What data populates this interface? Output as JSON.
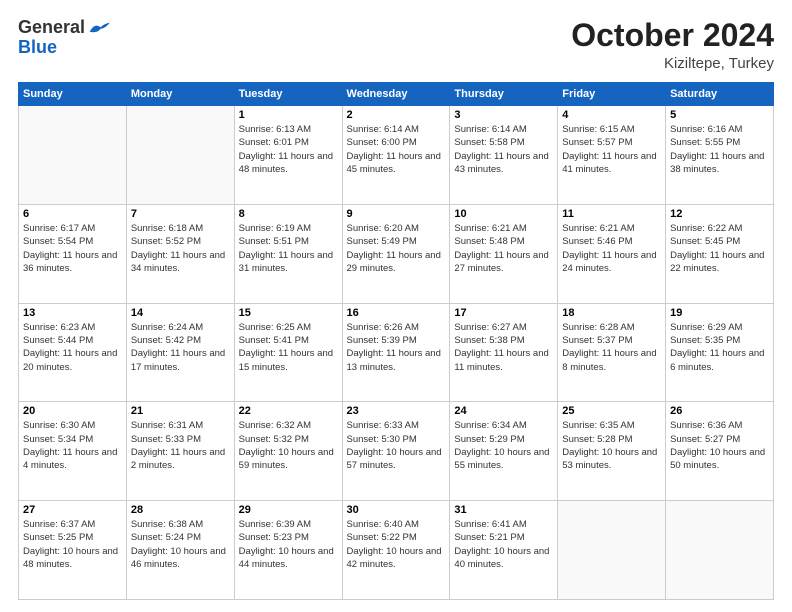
{
  "logo": {
    "line1": "General",
    "line2": "Blue"
  },
  "title": "October 2024",
  "location": "Kiziltepe, Turkey",
  "weekdays": [
    "Sunday",
    "Monday",
    "Tuesday",
    "Wednesday",
    "Thursday",
    "Friday",
    "Saturday"
  ],
  "weeks": [
    [
      {
        "day": "",
        "info": ""
      },
      {
        "day": "",
        "info": ""
      },
      {
        "day": "1",
        "info": "Sunrise: 6:13 AM\nSunset: 6:01 PM\nDaylight: 11 hours and 48 minutes."
      },
      {
        "day": "2",
        "info": "Sunrise: 6:14 AM\nSunset: 6:00 PM\nDaylight: 11 hours and 45 minutes."
      },
      {
        "day": "3",
        "info": "Sunrise: 6:14 AM\nSunset: 5:58 PM\nDaylight: 11 hours and 43 minutes."
      },
      {
        "day": "4",
        "info": "Sunrise: 6:15 AM\nSunset: 5:57 PM\nDaylight: 11 hours and 41 minutes."
      },
      {
        "day": "5",
        "info": "Sunrise: 6:16 AM\nSunset: 5:55 PM\nDaylight: 11 hours and 38 minutes."
      }
    ],
    [
      {
        "day": "6",
        "info": "Sunrise: 6:17 AM\nSunset: 5:54 PM\nDaylight: 11 hours and 36 minutes."
      },
      {
        "day": "7",
        "info": "Sunrise: 6:18 AM\nSunset: 5:52 PM\nDaylight: 11 hours and 34 minutes."
      },
      {
        "day": "8",
        "info": "Sunrise: 6:19 AM\nSunset: 5:51 PM\nDaylight: 11 hours and 31 minutes."
      },
      {
        "day": "9",
        "info": "Sunrise: 6:20 AM\nSunset: 5:49 PM\nDaylight: 11 hours and 29 minutes."
      },
      {
        "day": "10",
        "info": "Sunrise: 6:21 AM\nSunset: 5:48 PM\nDaylight: 11 hours and 27 minutes."
      },
      {
        "day": "11",
        "info": "Sunrise: 6:21 AM\nSunset: 5:46 PM\nDaylight: 11 hours and 24 minutes."
      },
      {
        "day": "12",
        "info": "Sunrise: 6:22 AM\nSunset: 5:45 PM\nDaylight: 11 hours and 22 minutes."
      }
    ],
    [
      {
        "day": "13",
        "info": "Sunrise: 6:23 AM\nSunset: 5:44 PM\nDaylight: 11 hours and 20 minutes."
      },
      {
        "day": "14",
        "info": "Sunrise: 6:24 AM\nSunset: 5:42 PM\nDaylight: 11 hours and 17 minutes."
      },
      {
        "day": "15",
        "info": "Sunrise: 6:25 AM\nSunset: 5:41 PM\nDaylight: 11 hours and 15 minutes."
      },
      {
        "day": "16",
        "info": "Sunrise: 6:26 AM\nSunset: 5:39 PM\nDaylight: 11 hours and 13 minutes."
      },
      {
        "day": "17",
        "info": "Sunrise: 6:27 AM\nSunset: 5:38 PM\nDaylight: 11 hours and 11 minutes."
      },
      {
        "day": "18",
        "info": "Sunrise: 6:28 AM\nSunset: 5:37 PM\nDaylight: 11 hours and 8 minutes."
      },
      {
        "day": "19",
        "info": "Sunrise: 6:29 AM\nSunset: 5:35 PM\nDaylight: 11 hours and 6 minutes."
      }
    ],
    [
      {
        "day": "20",
        "info": "Sunrise: 6:30 AM\nSunset: 5:34 PM\nDaylight: 11 hours and 4 minutes."
      },
      {
        "day": "21",
        "info": "Sunrise: 6:31 AM\nSunset: 5:33 PM\nDaylight: 11 hours and 2 minutes."
      },
      {
        "day": "22",
        "info": "Sunrise: 6:32 AM\nSunset: 5:32 PM\nDaylight: 10 hours and 59 minutes."
      },
      {
        "day": "23",
        "info": "Sunrise: 6:33 AM\nSunset: 5:30 PM\nDaylight: 10 hours and 57 minutes."
      },
      {
        "day": "24",
        "info": "Sunrise: 6:34 AM\nSunset: 5:29 PM\nDaylight: 10 hours and 55 minutes."
      },
      {
        "day": "25",
        "info": "Sunrise: 6:35 AM\nSunset: 5:28 PM\nDaylight: 10 hours and 53 minutes."
      },
      {
        "day": "26",
        "info": "Sunrise: 6:36 AM\nSunset: 5:27 PM\nDaylight: 10 hours and 50 minutes."
      }
    ],
    [
      {
        "day": "27",
        "info": "Sunrise: 6:37 AM\nSunset: 5:25 PM\nDaylight: 10 hours and 48 minutes."
      },
      {
        "day": "28",
        "info": "Sunrise: 6:38 AM\nSunset: 5:24 PM\nDaylight: 10 hours and 46 minutes."
      },
      {
        "day": "29",
        "info": "Sunrise: 6:39 AM\nSunset: 5:23 PM\nDaylight: 10 hours and 44 minutes."
      },
      {
        "day": "30",
        "info": "Sunrise: 6:40 AM\nSunset: 5:22 PM\nDaylight: 10 hours and 42 minutes."
      },
      {
        "day": "31",
        "info": "Sunrise: 6:41 AM\nSunset: 5:21 PM\nDaylight: 10 hours and 40 minutes."
      },
      {
        "day": "",
        "info": ""
      },
      {
        "day": "",
        "info": ""
      }
    ]
  ]
}
